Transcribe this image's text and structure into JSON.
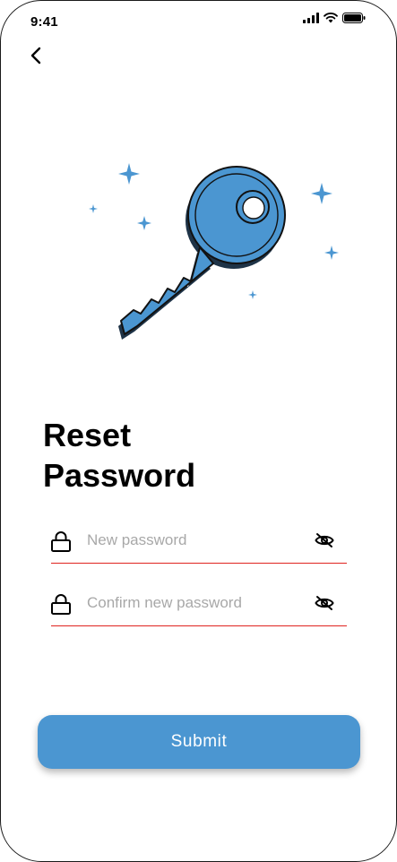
{
  "status_bar": {
    "time": "9:41"
  },
  "page": {
    "title_line1": "Reset",
    "title_line2": "Password"
  },
  "form": {
    "new_password": {
      "value": "",
      "placeholder": "New password"
    },
    "confirm_password": {
      "value": "",
      "placeholder": "Confirm new password"
    },
    "submit_label": "Submit"
  },
  "colors": {
    "accent": "#4b96d1",
    "underline": "#e0241f",
    "placeholder": "#a8a8a8"
  },
  "icons": [
    "chevron-left-icon",
    "lock-icon",
    "eye-off-icon",
    "key-illustration",
    "sparkle-icon"
  ]
}
